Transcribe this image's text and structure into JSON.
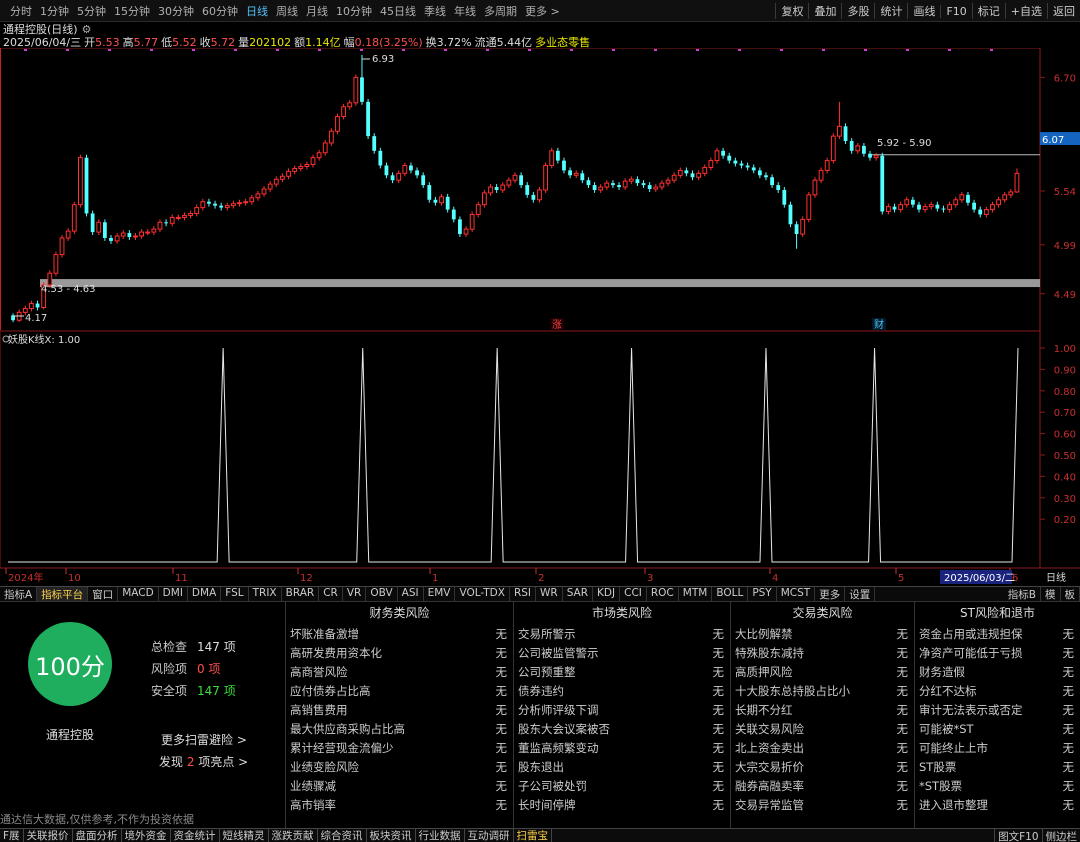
{
  "timeframe_bar": {
    "items": [
      "分时",
      "1分钟",
      "5分钟",
      "15分钟",
      "30分钟",
      "60分钟",
      "日线",
      "周线",
      "月线",
      "10分钟",
      "45日线",
      "季线",
      "年线",
      "多周期",
      "更多 >"
    ],
    "active": "日线",
    "right_buttons": [
      "复权",
      "叠加",
      "多股",
      "统计",
      "画线",
      "F10",
      "标记",
      "+自选",
      "返回"
    ]
  },
  "info": {
    "title": "通程控股(日线)",
    "date": "2025/06/04/三",
    "open_label": "开",
    "open": "5.53",
    "high_label": "高",
    "high": "5.77",
    "low_label": "低",
    "low": "5.52",
    "close_label": "收",
    "close": "5.72",
    "vol_label": "量",
    "vol": "202102",
    "amount_label": "额",
    "amount": "1.14亿",
    "change_label": "幅",
    "change": "0.18(3.25%)",
    "turnover_label": "换",
    "turnover": "3.72%",
    "float_label": "流通",
    "float": "5.44亿",
    "sector": "多业态零售"
  },
  "chart_data": {
    "type": "candlestick",
    "price_axis": {
      "ticks": [
        "6.70",
        "6.07",
        "5.54",
        "4.99",
        "4.49"
      ],
      "range": [
        4.2,
        7.0
      ],
      "current_price_tag": "6.07"
    },
    "annotations": {
      "high": "6.93",
      "low": "4.17",
      "band_low": "4.53 - 4.63",
      "band_high": "5.92 - 5.90",
      "event_rise": "涨",
      "event_fin": "财"
    },
    "candles": [
      [
        4.27,
        4.22,
        4.29,
        4.2
      ],
      [
        4.22,
        4.3,
        4.33,
        4.2
      ],
      [
        4.3,
        4.34,
        4.37,
        4.27
      ],
      [
        4.34,
        4.39,
        4.42,
        4.31
      ],
      [
        4.39,
        4.35,
        4.42,
        4.32
      ],
      [
        4.35,
        4.58,
        4.61,
        4.33
      ],
      [
        4.58,
        4.7,
        4.73,
        4.55
      ],
      [
        4.7,
        4.89,
        4.92,
        4.67
      ],
      [
        4.89,
        5.06,
        5.09,
        4.86
      ],
      [
        5.06,
        5.13,
        5.16,
        5.03
      ],
      [
        5.13,
        5.4,
        5.43,
        5.1
      ],
      [
        5.4,
        5.88,
        5.91,
        5.37
      ],
      [
        5.88,
        5.31,
        5.91,
        5.28
      ],
      [
        5.31,
        5.12,
        5.34,
        5.09
      ],
      [
        5.12,
        5.22,
        5.25,
        5.09
      ],
      [
        5.22,
        5.06,
        5.25,
        5.03
      ],
      [
        5.06,
        5.03,
        5.09,
        5.0
      ],
      [
        5.03,
        5.08,
        5.11,
        5.0
      ],
      [
        5.08,
        5.11,
        5.14,
        5.05
      ],
      [
        5.11,
        5.07,
        5.14,
        5.04
      ],
      [
        5.07,
        5.08,
        5.11,
        5.04
      ],
      [
        5.08,
        5.12,
        5.15,
        5.05
      ],
      [
        5.12,
        5.12,
        5.15,
        5.09
      ],
      [
        5.12,
        5.15,
        5.18,
        5.09
      ],
      [
        5.15,
        5.22,
        5.25,
        5.12
      ],
      [
        5.22,
        5.21,
        5.25,
        5.18
      ],
      [
        5.21,
        5.27,
        5.3,
        5.18
      ],
      [
        5.27,
        5.27,
        5.3,
        5.24
      ],
      [
        5.27,
        5.29,
        5.32,
        5.24
      ],
      [
        5.29,
        5.31,
        5.34,
        5.26
      ],
      [
        5.31,
        5.37,
        5.4,
        5.28
      ],
      [
        5.37,
        5.43,
        5.46,
        5.34
      ],
      [
        5.43,
        5.41,
        5.46,
        5.38
      ],
      [
        5.41,
        5.39,
        5.44,
        5.36
      ],
      [
        5.39,
        5.37,
        5.42,
        5.34
      ],
      [
        5.37,
        5.39,
        5.42,
        5.34
      ],
      [
        5.39,
        5.41,
        5.44,
        5.36
      ],
      [
        5.41,
        5.42,
        5.45,
        5.38
      ],
      [
        5.42,
        5.43,
        5.46,
        5.39
      ],
      [
        5.43,
        5.47,
        5.5,
        5.4
      ],
      [
        5.47,
        5.51,
        5.54,
        5.44
      ],
      [
        5.51,
        5.56,
        5.59,
        5.48
      ],
      [
        5.56,
        5.61,
        5.64,
        5.53
      ],
      [
        5.61,
        5.66,
        5.69,
        5.58
      ],
      [
        5.66,
        5.69,
        5.72,
        5.63
      ],
      [
        5.69,
        5.74,
        5.77,
        5.66
      ],
      [
        5.74,
        5.77,
        5.8,
        5.71
      ],
      [
        5.77,
        5.79,
        5.82,
        5.74
      ],
      [
        5.79,
        5.81,
        5.84,
        5.76
      ],
      [
        5.81,
        5.88,
        5.91,
        5.78
      ],
      [
        5.88,
        5.93,
        5.96,
        5.85
      ],
      [
        5.93,
        6.03,
        6.06,
        5.9
      ],
      [
        6.03,
        6.15,
        6.18,
        6.0
      ],
      [
        6.15,
        6.3,
        6.33,
        6.12
      ],
      [
        6.3,
        6.4,
        6.43,
        6.27
      ],
      [
        6.4,
        6.44,
        6.47,
        6.37
      ],
      [
        6.44,
        6.7,
        6.73,
        6.41
      ],
      [
        6.7,
        6.45,
        6.93,
        6.42
      ],
      [
        6.45,
        6.1,
        6.48,
        6.07
      ],
      [
        6.1,
        5.95,
        6.13,
        5.92
      ],
      [
        5.95,
        5.8,
        5.98,
        5.77
      ],
      [
        5.8,
        5.7,
        5.83,
        5.67
      ],
      [
        5.7,
        5.65,
        5.73,
        5.62
      ],
      [
        5.65,
        5.72,
        5.75,
        5.62
      ],
      [
        5.72,
        5.8,
        5.83,
        5.69
      ],
      [
        5.8,
        5.75,
        5.83,
        5.72
      ],
      [
        5.75,
        5.7,
        5.78,
        5.67
      ],
      [
        5.7,
        5.6,
        5.73,
        5.57
      ],
      [
        5.6,
        5.45,
        5.63,
        5.42
      ],
      [
        5.45,
        5.42,
        5.48,
        5.39
      ],
      [
        5.42,
        5.48,
        5.51,
        5.39
      ],
      [
        5.48,
        5.35,
        5.51,
        5.32
      ],
      [
        5.35,
        5.25,
        5.38,
        5.22
      ],
      [
        5.25,
        5.1,
        5.28,
        5.07
      ],
      [
        5.1,
        5.15,
        5.18,
        5.07
      ],
      [
        5.15,
        5.3,
        5.33,
        5.12
      ],
      [
        5.3,
        5.4,
        5.43,
        5.27
      ],
      [
        5.4,
        5.52,
        5.55,
        5.37
      ],
      [
        5.52,
        5.58,
        5.61,
        5.49
      ],
      [
        5.58,
        5.55,
        5.61,
        5.52
      ],
      [
        5.55,
        5.6,
        5.63,
        5.52
      ],
      [
        5.6,
        5.65,
        5.68,
        5.57
      ],
      [
        5.65,
        5.7,
        5.73,
        5.62
      ],
      [
        5.7,
        5.6,
        5.73,
        5.57
      ],
      [
        5.6,
        5.5,
        5.63,
        5.47
      ],
      [
        5.5,
        5.45,
        5.53,
        5.42
      ],
      [
        5.45,
        5.55,
        5.58,
        5.42
      ],
      [
        5.55,
        5.8,
        5.83,
        5.52
      ],
      [
        5.8,
        5.95,
        5.98,
        5.77
      ],
      [
        5.95,
        5.85,
        5.98,
        5.82
      ],
      [
        5.85,
        5.75,
        5.88,
        5.72
      ],
      [
        5.75,
        5.7,
        5.78,
        5.67
      ],
      [
        5.7,
        5.72,
        5.75,
        5.67
      ],
      [
        5.72,
        5.65,
        5.75,
        5.62
      ],
      [
        5.65,
        5.6,
        5.68,
        5.57
      ],
      [
        5.6,
        5.55,
        5.63,
        5.52
      ],
      [
        5.55,
        5.58,
        5.61,
        5.52
      ],
      [
        5.58,
        5.62,
        5.65,
        5.55
      ],
      [
        5.62,
        5.6,
        5.65,
        5.57
      ],
      [
        5.6,
        5.58,
        5.63,
        5.55
      ],
      [
        5.58,
        5.64,
        5.67,
        5.55
      ],
      [
        5.64,
        5.66,
        5.69,
        5.61
      ],
      [
        5.66,
        5.62,
        5.69,
        5.59
      ],
      [
        5.62,
        5.6,
        5.65,
        5.57
      ],
      [
        5.6,
        5.56,
        5.63,
        5.53
      ],
      [
        5.56,
        5.58,
        5.61,
        5.53
      ],
      [
        5.58,
        5.62,
        5.65,
        5.55
      ],
      [
        5.62,
        5.65,
        5.68,
        5.59
      ],
      [
        5.65,
        5.7,
        5.73,
        5.62
      ],
      [
        5.7,
        5.75,
        5.78,
        5.67
      ],
      [
        5.75,
        5.72,
        5.78,
        5.69
      ],
      [
        5.72,
        5.68,
        5.75,
        5.65
      ],
      [
        5.68,
        5.72,
        5.75,
        5.65
      ],
      [
        5.72,
        5.78,
        5.81,
        5.69
      ],
      [
        5.78,
        5.85,
        5.88,
        5.75
      ],
      [
        5.85,
        5.95,
        5.98,
        5.82
      ],
      [
        5.95,
        5.9,
        5.98,
        5.87
      ],
      [
        5.9,
        5.85,
        5.93,
        5.82
      ],
      [
        5.85,
        5.82,
        5.88,
        5.79
      ],
      [
        5.82,
        5.8,
        5.85,
        5.77
      ],
      [
        5.8,
        5.78,
        5.83,
        5.75
      ],
      [
        5.78,
        5.75,
        5.81,
        5.72
      ],
      [
        5.75,
        5.7,
        5.78,
        5.67
      ],
      [
        5.7,
        5.68,
        5.73,
        5.65
      ],
      [
        5.68,
        5.6,
        5.71,
        5.57
      ],
      [
        5.6,
        5.55,
        5.63,
        5.52
      ],
      [
        5.55,
        5.4,
        5.58,
        5.37
      ],
      [
        5.4,
        5.2,
        5.43,
        5.17
      ],
      [
        5.2,
        5.1,
        5.23,
        4.95
      ],
      [
        5.1,
        5.25,
        5.28,
        5.07
      ],
      [
        5.25,
        5.5,
        5.53,
        5.22
      ],
      [
        5.5,
        5.65,
        5.68,
        5.47
      ],
      [
        5.65,
        5.75,
        5.78,
        5.62
      ],
      [
        5.75,
        5.85,
        5.88,
        5.72
      ],
      [
        5.85,
        6.1,
        6.13,
        5.82
      ],
      [
        6.1,
        6.2,
        6.45,
        6.07
      ],
      [
        6.2,
        6.05,
        6.23,
        6.02
      ],
      [
        6.05,
        5.95,
        6.08,
        5.92
      ],
      [
        5.95,
        6.0,
        6.03,
        5.92
      ],
      [
        6.0,
        5.92,
        6.03,
        5.89
      ],
      [
        5.92,
        5.88,
        5.95,
        5.85
      ],
      [
        5.88,
        5.9,
        5.93,
        5.85
      ],
      [
        5.9,
        5.33,
        5.93,
        5.3
      ],
      [
        5.33,
        5.38,
        5.41,
        5.3
      ],
      [
        5.38,
        5.35,
        5.41,
        5.32
      ],
      [
        5.35,
        5.4,
        5.43,
        5.32
      ],
      [
        5.4,
        5.45,
        5.48,
        5.37
      ],
      [
        5.45,
        5.4,
        5.48,
        5.37
      ],
      [
        5.4,
        5.35,
        5.43,
        5.32
      ],
      [
        5.35,
        5.38,
        5.41,
        5.32
      ],
      [
        5.38,
        5.4,
        5.43,
        5.35
      ],
      [
        5.4,
        5.36,
        5.43,
        5.33
      ],
      [
        5.36,
        5.35,
        5.39,
        5.32
      ],
      [
        5.35,
        5.4,
        5.43,
        5.32
      ],
      [
        5.4,
        5.45,
        5.48,
        5.37
      ],
      [
        5.45,
        5.5,
        5.53,
        5.42
      ],
      [
        5.5,
        5.42,
        5.53,
        5.39
      ],
      [
        5.42,
        5.35,
        5.45,
        5.32
      ],
      [
        5.35,
        5.3,
        5.38,
        5.27
      ],
      [
        5.3,
        5.35,
        5.38,
        5.27
      ],
      [
        5.35,
        5.4,
        5.43,
        5.32
      ],
      [
        5.4,
        5.45,
        5.48,
        5.37
      ],
      [
        5.45,
        5.5,
        5.53,
        5.42
      ],
      [
        5.5,
        5.53,
        5.56,
        5.47
      ],
      [
        5.53,
        5.72,
        5.77,
        5.52
      ]
    ],
    "indicator": {
      "name": "妖股K线",
      "label": "妖股K线X: 1.00",
      "ticks": [
        "1.00",
        "0.90",
        "0.80",
        "0.70",
        "0.60",
        "0.50",
        "0.40",
        "0.30",
        "0.20"
      ],
      "spike_positions": [
        0.21,
        0.345,
        0.475,
        0.605,
        0.735,
        0.84
      ],
      "range": [
        0,
        1
      ]
    },
    "date_axis": {
      "labels": [
        "2024年",
        "10",
        "11",
        "12",
        "1",
        "2",
        "3",
        "4",
        "5",
        "6"
      ],
      "current_date": "2025/06/03/二",
      "period_button": "日线"
    }
  },
  "indicator_tabs": {
    "items": [
      "指标A",
      "指标平台",
      "窗口",
      "MACD",
      "DMI",
      "DMA",
      "FSL",
      "TRIX",
      "BRAR",
      "CR",
      "VR",
      "OBV",
      "ASI",
      "EMV",
      "VOL-TDX",
      "RSI",
      "WR",
      "SAR",
      "KDJ",
      "CCI",
      "ROC",
      "MTM",
      "BOLL",
      "PSY",
      "MCST",
      "更多",
      "设置"
    ],
    "active": "指标平台",
    "right": [
      "指标B",
      "模",
      "板"
    ]
  },
  "risk_panel": {
    "score": "100分",
    "total_label": "总检查",
    "total": "147 项",
    "risk_label": "风险项",
    "risk": "0 项",
    "safe_label": "安全项",
    "safe": "147 项",
    "stock_name": "通程控股",
    "more_link": "更多扫雷避险 >",
    "found_pre": "发现",
    "found_count": "2",
    "found_post": "项亮点 >",
    "disclaimer": "通达信大数据,仅供参考,不作为投资依据",
    "columns": [
      {
        "title": "财务类风险",
        "items": [
          {
            "label": "坏账准备激增",
            "status": "无"
          },
          {
            "label": "高研发费用资本化",
            "status": "无"
          },
          {
            "label": "高商誉风险",
            "status": "无"
          },
          {
            "label": "应付债券占比高",
            "status": "无"
          },
          {
            "label": "高销售费用",
            "status": "无"
          },
          {
            "label": "最大供应商采购占比高",
            "status": "无"
          },
          {
            "label": "累计经营现金流偏少",
            "status": "无"
          },
          {
            "label": "业绩变脸风险",
            "status": "无"
          },
          {
            "label": "业绩骤减",
            "status": "无"
          },
          {
            "label": "高市销率",
            "status": "无"
          }
        ]
      },
      {
        "title": "市场类风险",
        "items": [
          {
            "label": "交易所警示",
            "status": "无"
          },
          {
            "label": "公司被监管警示",
            "status": "无"
          },
          {
            "label": "公司预重整",
            "status": "无"
          },
          {
            "label": "债券违约",
            "status": "无"
          },
          {
            "label": "分析师评级下调",
            "status": "无"
          },
          {
            "label": "股东大会议案被否",
            "status": "无"
          },
          {
            "label": "董监高频繁变动",
            "status": "无"
          },
          {
            "label": "股东退出",
            "status": "无"
          },
          {
            "label": "子公司被处罚",
            "status": "无"
          },
          {
            "label": "长时间停牌",
            "status": "无"
          }
        ]
      },
      {
        "title": "交易类风险",
        "items": [
          {
            "label": "大比例解禁",
            "status": "无"
          },
          {
            "label": "特殊股东减持",
            "status": "无"
          },
          {
            "label": "高质押风险",
            "status": "无"
          },
          {
            "label": "十大股东总持股占比小",
            "status": "无"
          },
          {
            "label": "长期不分红",
            "status": "无"
          },
          {
            "label": "关联交易风险",
            "status": "无"
          },
          {
            "label": "北上资金卖出",
            "status": "无"
          },
          {
            "label": "大宗交易折价",
            "status": "无"
          },
          {
            "label": "融券高融卖率",
            "status": "无"
          },
          {
            "label": "交易异常监管",
            "status": "无"
          }
        ]
      },
      {
        "title": "ST风险和退市",
        "items": [
          {
            "label": "资金占用或违规担保",
            "status": "无"
          },
          {
            "label": "净资产可能低于亏损",
            "status": "无"
          },
          {
            "label": "财务造假",
            "status": "无"
          },
          {
            "label": "分红不达标",
            "status": "无"
          },
          {
            "label": "审计无法表示或否定",
            "status": "无"
          },
          {
            "label": "可能被*ST",
            "status": "无"
          },
          {
            "label": "可能终止上市",
            "status": "无"
          },
          {
            "label": "ST股票",
            "status": "无"
          },
          {
            "label": "*ST股票",
            "status": "无"
          },
          {
            "label": "进入退市整理",
            "status": "无"
          }
        ]
      }
    ]
  },
  "status_bar": {
    "items": [
      "F展",
      "关联报价",
      "盘面分析",
      "境外资金",
      "资金统计",
      "短线精灵",
      "涨跌贡献",
      "综合资讯",
      "板块资讯",
      "行业数据",
      "互动调研",
      "扫雷宝"
    ],
    "active": "扫雷宝",
    "right": [
      "图文F10",
      "侧边栏"
    ]
  },
  "colors": {
    "up": "#ff3030",
    "down": "#54ffff",
    "accent": "#4fc3f7",
    "score_green": "#1fae5e"
  }
}
